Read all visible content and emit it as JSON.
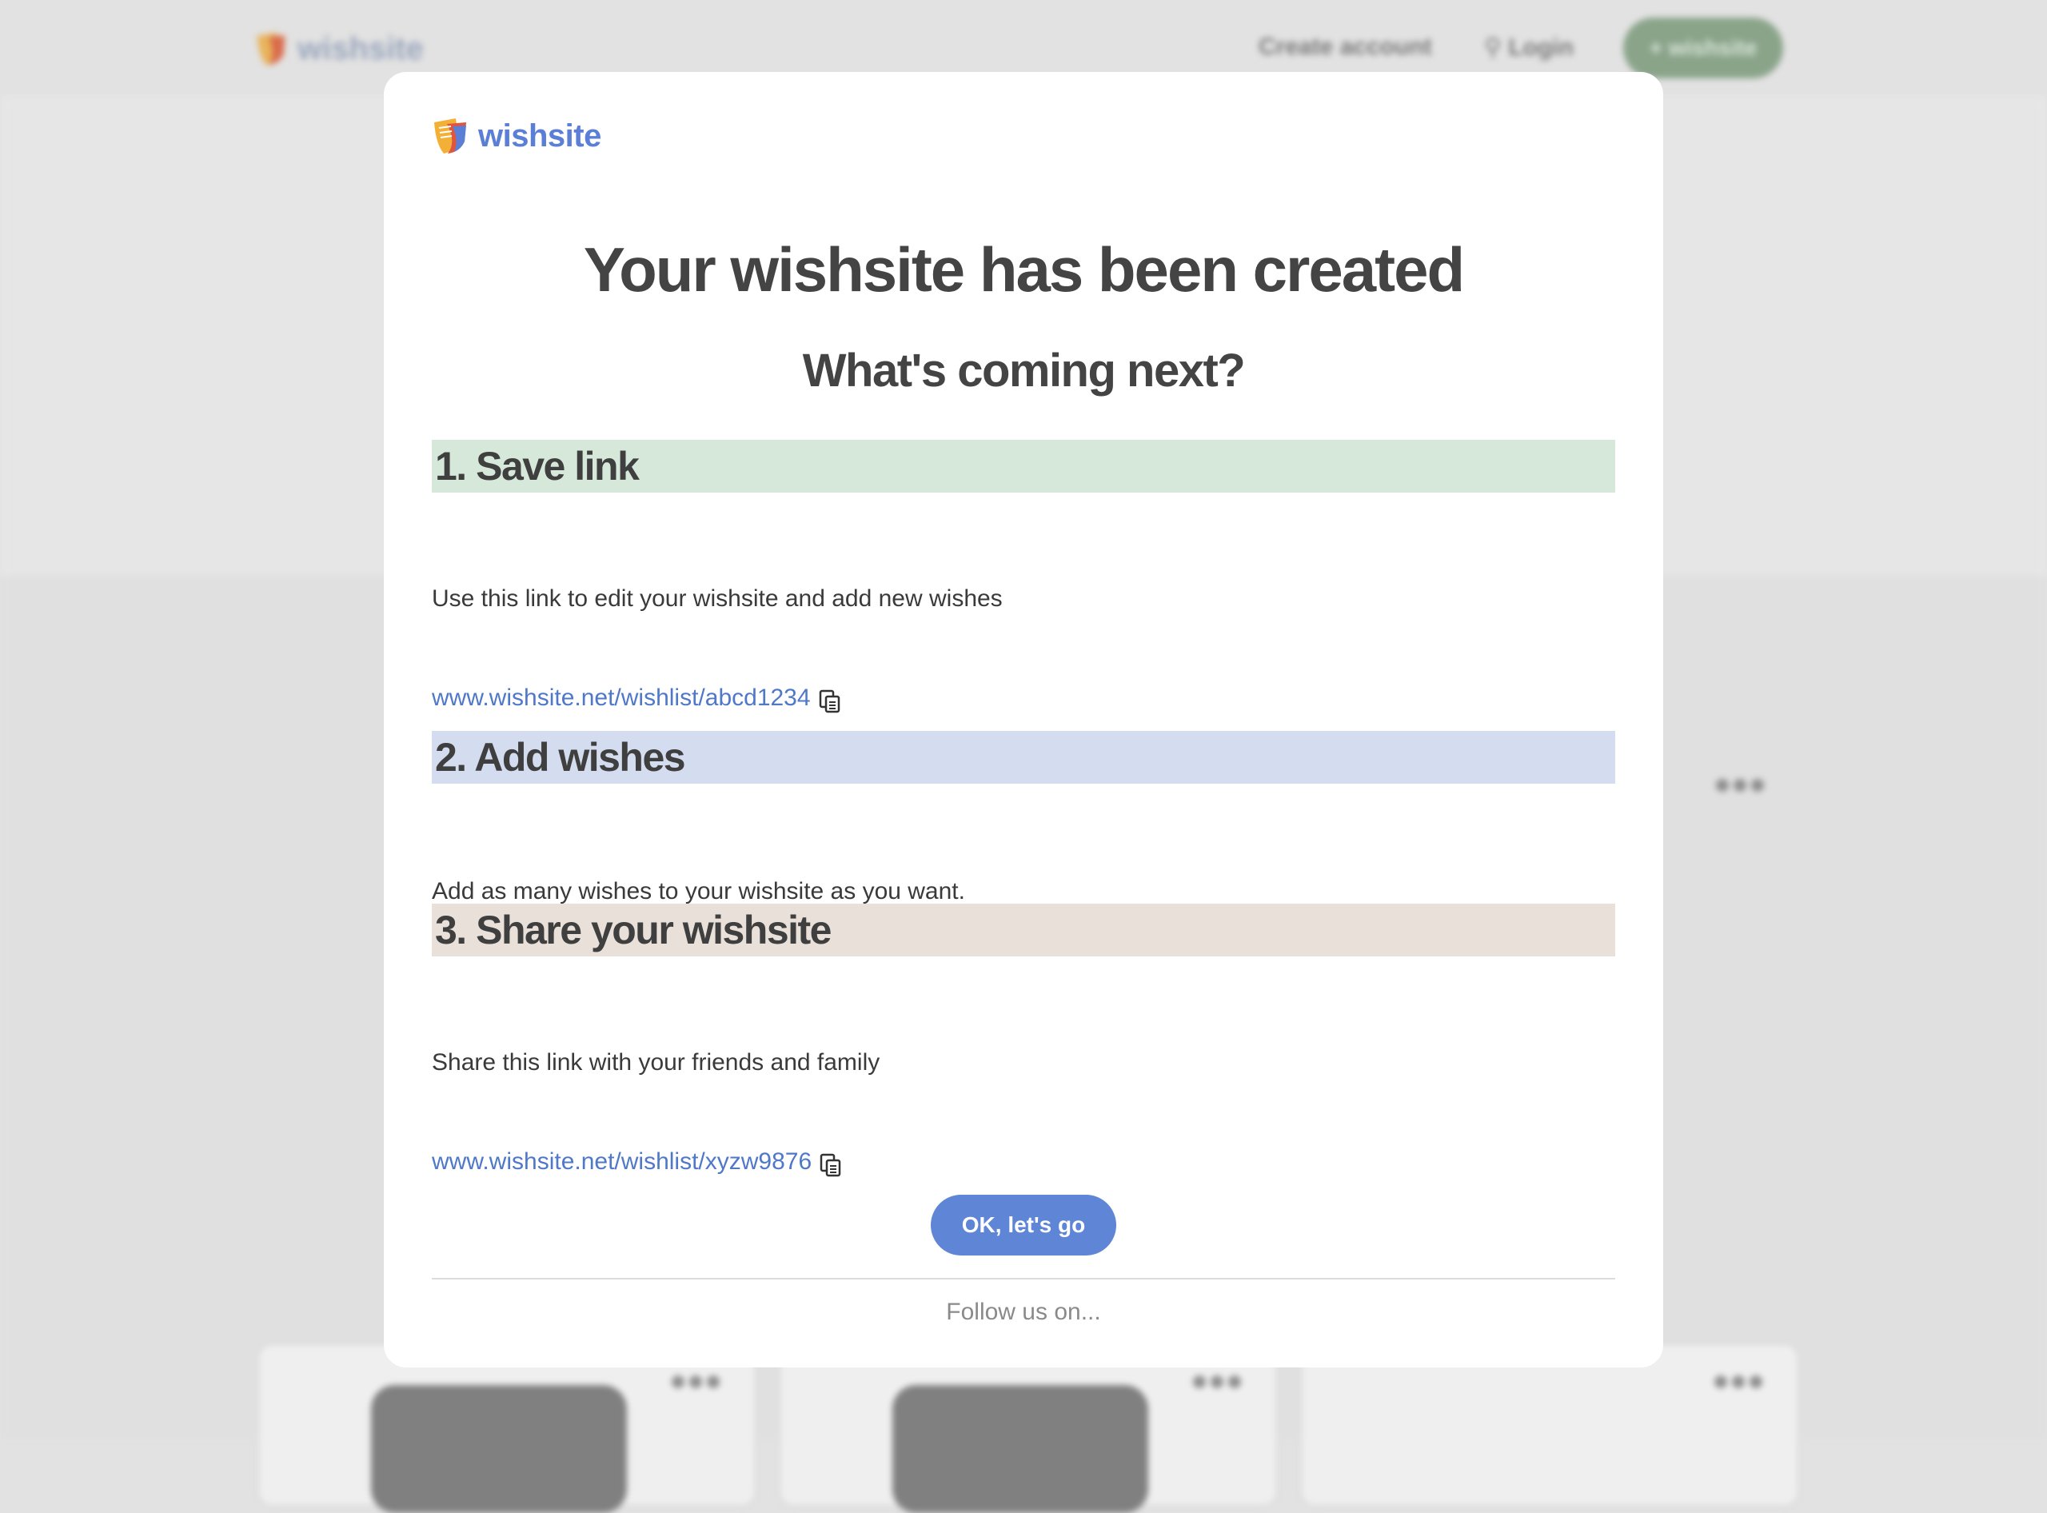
{
  "background": {
    "logo_text": "wishsite",
    "nav": {
      "create_account": "Create account",
      "login": "Login",
      "cta": "+ wishsite"
    }
  },
  "modal": {
    "logo_text": "wishsite",
    "title": "Your wishsite has been created",
    "subtitle": "What's coming next?",
    "steps": [
      {
        "heading": "1. Save link",
        "text": "Use this link to edit your wishsite and add new wishes",
        "link": "www.wishsite.net/wishlist/abcd1234",
        "color": "#d6e8da"
      },
      {
        "heading": "2. Add wishes",
        "text": "Add as many wishes to your wishsite as you want.",
        "color": "#d4dcef"
      },
      {
        "heading": "3. Share your wishsite",
        "text": "Share this link with your friends and family",
        "link": "www.wishsite.net/wishlist/xyzw9876",
        "color": "#e8e0d9"
      }
    ],
    "ok_button": "OK, let's go",
    "follow_text": "Follow us on..."
  },
  "colors": {
    "accent": "#5f85d6",
    "link": "#4f78c9",
    "overlay": "#e2e2e2"
  },
  "icons": [
    "wishsite-logo-icon",
    "copy-icon",
    "more-dots-icon",
    "user-icon"
  ]
}
